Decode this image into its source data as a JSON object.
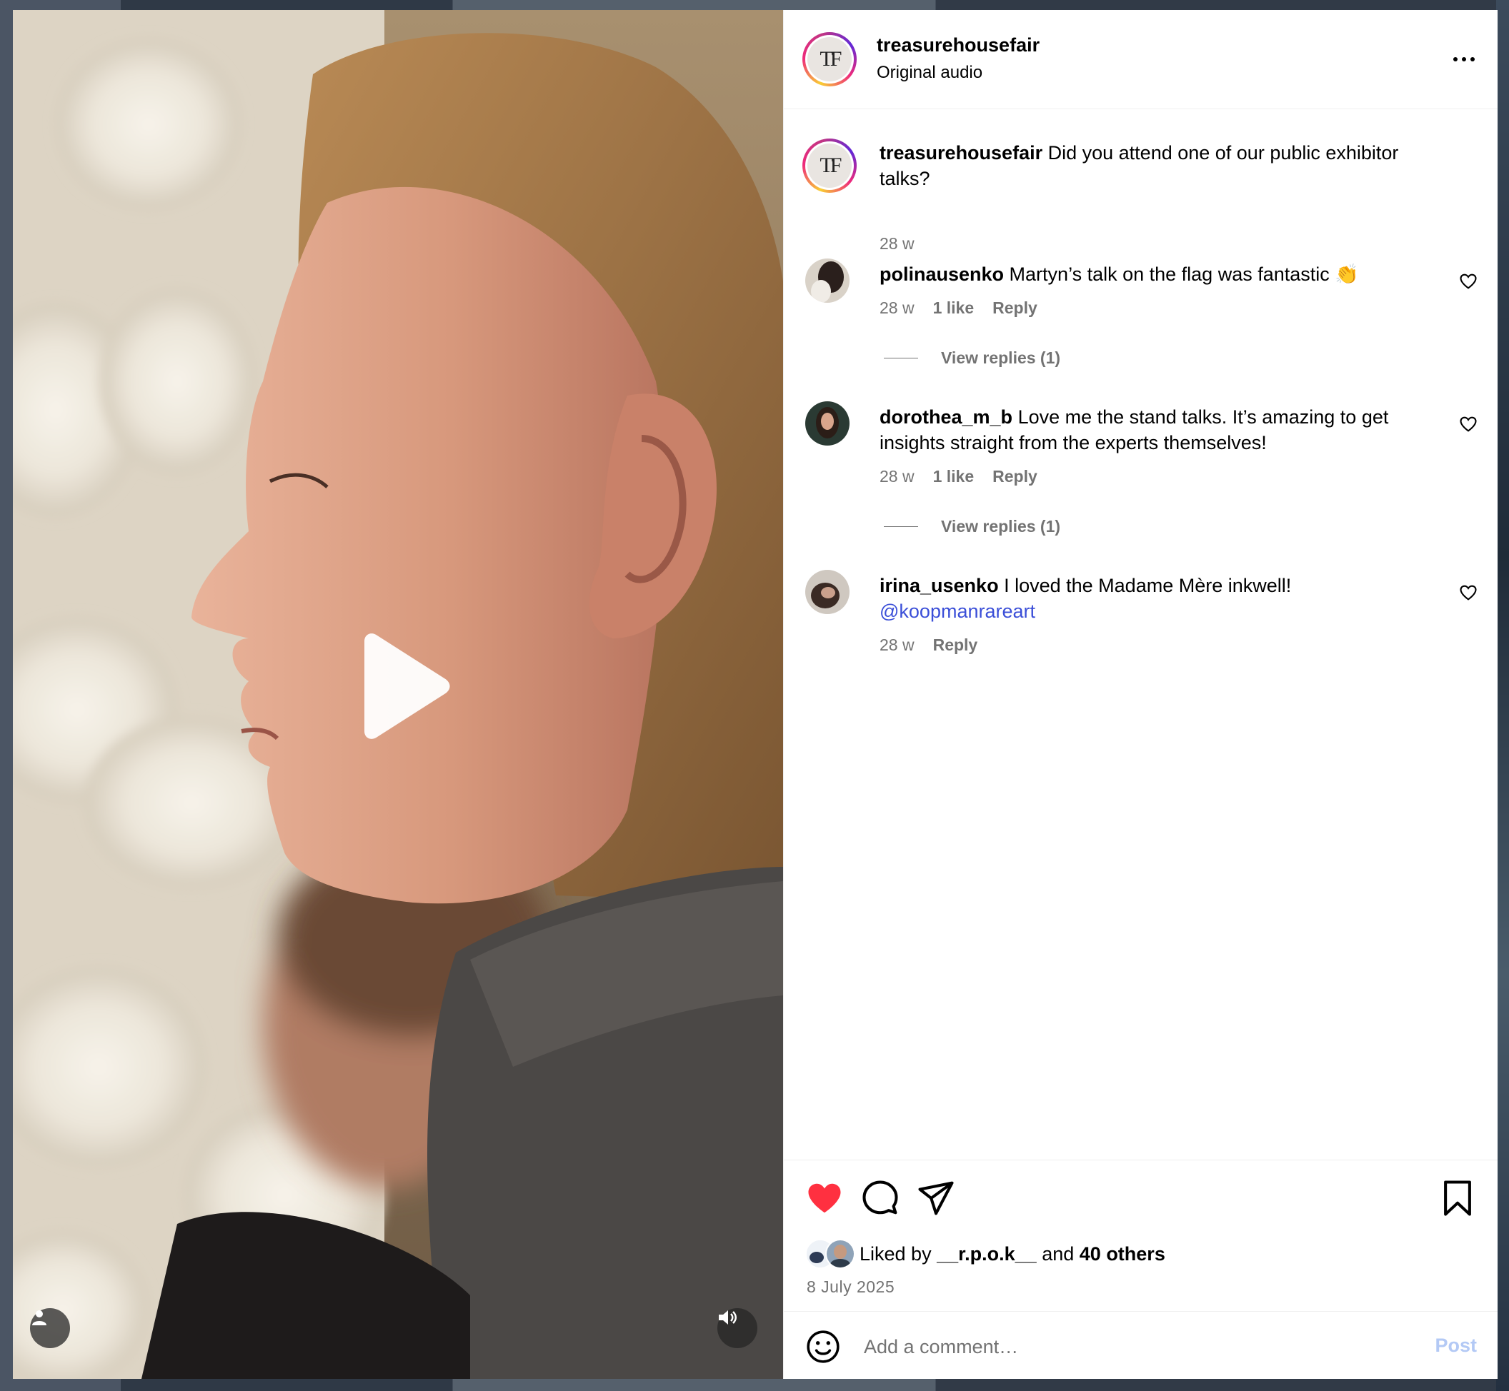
{
  "post": {
    "username": "treasurehousefair",
    "audio": "Original audio",
    "logo_text": "TF",
    "caption": "Did you attend one of our public exhibitor talks?",
    "caption_age": "28 w"
  },
  "comments": [
    {
      "username": "polinausenko",
      "text": "Martyn’s talk on the flag was fantastic 👏",
      "age": "28 w",
      "likes": "1 like",
      "reply": "Reply",
      "view_replies": "View replies (1)"
    },
    {
      "username": "dorothea_m_b",
      "text": "Love me the stand talks. It’s amazing to get insights straight from the experts themselves!",
      "age": "28 w",
      "likes": "1 like",
      "reply": "Reply",
      "view_replies": "View replies (1)"
    },
    {
      "username": "irina_usenko",
      "text": "I loved the Madame Mère inkwell!",
      "mention": "@koopmanrareart",
      "age": "28 w",
      "reply": "Reply"
    }
  ],
  "actions": {
    "liked_prefix": "Liked by",
    "liked_user": "__r.p.o.k__",
    "liked_and": "and",
    "liked_others": "40 others",
    "date": "8 July 2025",
    "liked": true
  },
  "composer": {
    "placeholder": "Add a comment…",
    "post_label": "Post"
  },
  "colors": {
    "like_red": "#ff3040",
    "mention_blue": "#3b4fd8",
    "post_disabled": "#b3c9f5",
    "muted_text": "#737373"
  },
  "icons": [
    "more-options-icon",
    "heart-icon",
    "comment-icon",
    "share-icon",
    "bookmark-icon",
    "emoji-icon",
    "play-icon",
    "user-tag-icon",
    "volume-icon"
  ]
}
